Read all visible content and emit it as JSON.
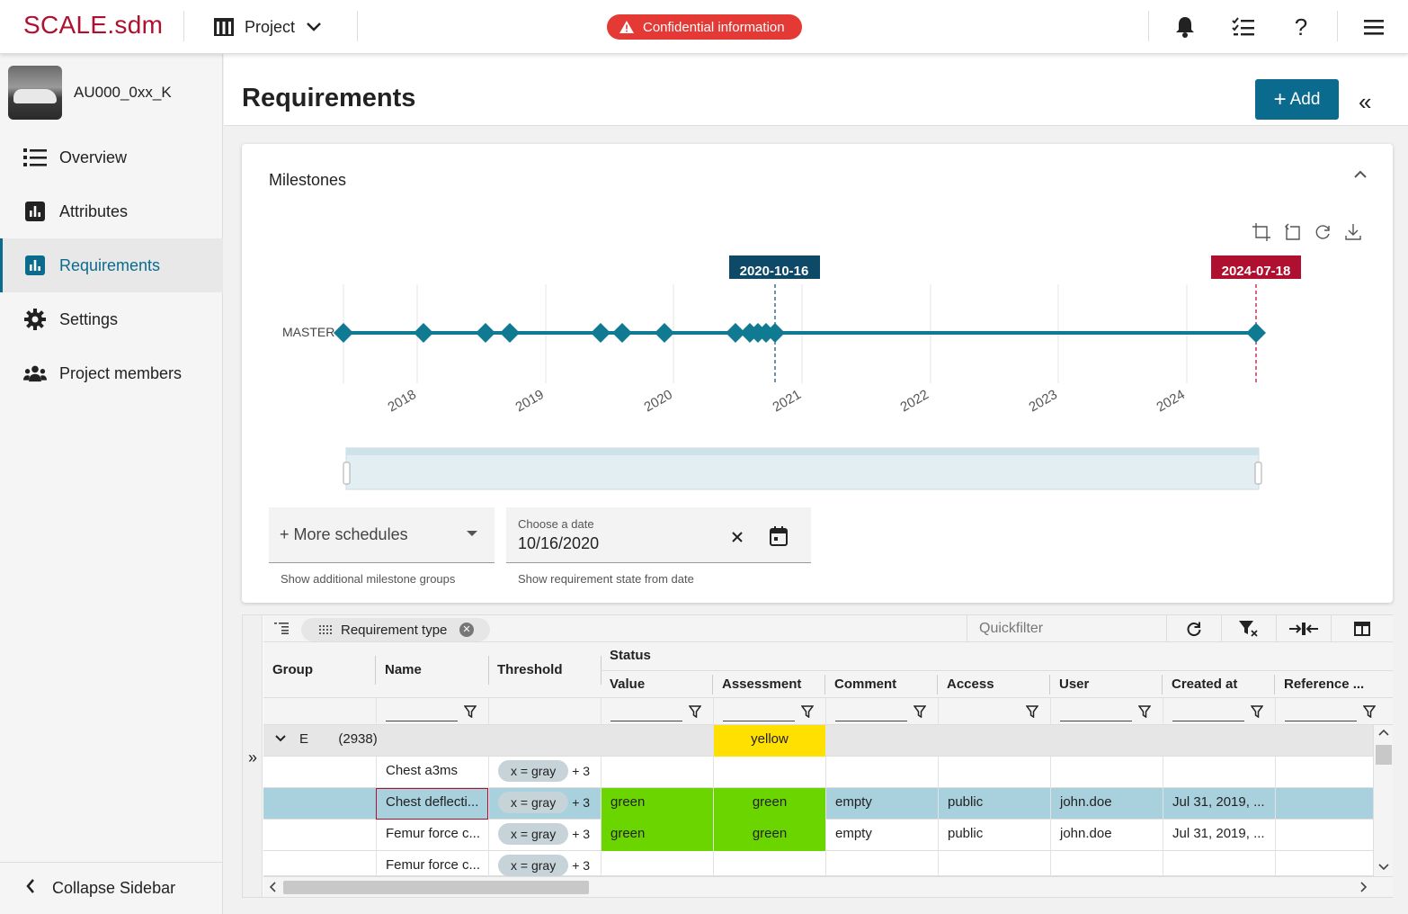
{
  "app": {
    "logo": "SCALE.sdm",
    "project_label": "Project",
    "confidential": "Confidential information"
  },
  "sidebar": {
    "project_name": "AU000_0xx_K",
    "items": [
      {
        "label": "Overview",
        "icon": "list-icon"
      },
      {
        "label": "Attributes",
        "icon": "bar-chart-icon"
      },
      {
        "label": "Requirements",
        "icon": "bar-chart-icon",
        "active": true
      },
      {
        "label": "Settings",
        "icon": "gear-icon"
      },
      {
        "label": "Project members",
        "icon": "people-icon"
      }
    ],
    "collapse_label": "Collapse Sidebar"
  },
  "header": {
    "title": "Requirements",
    "add_label": "Add"
  },
  "milestones": {
    "title": "Milestones",
    "series_label": "MASTER",
    "marker_left": "2020-10-16",
    "marker_right": "2024-07-18",
    "years": [
      "2018",
      "2019",
      "2020",
      "2021",
      "2022",
      "2023",
      "2024"
    ],
    "more_schedules": "More schedules",
    "more_schedules_hint": "Show additional milestone groups",
    "date_label": "Choose a date",
    "date_value": "10/16/2020",
    "date_hint": "Show requirement state from date"
  },
  "grid": {
    "group_chip": "Requirement type",
    "quickfilter_placeholder": "Quickfilter",
    "headers": {
      "group": "Group",
      "name": "Name",
      "threshold": "Threshold",
      "status": "Status",
      "value": "Value",
      "assessment": "Assessment",
      "comment": "Comment",
      "access": "Access",
      "user": "User",
      "created_at": "Created at",
      "reference": "Reference ..."
    },
    "group_row": {
      "label": "E",
      "count": "(2938)",
      "assessment": "yellow"
    },
    "rows": [
      {
        "name": "Chest a3ms",
        "threshold": "x = gray",
        "more": "+ 3",
        "value": "",
        "assessment": "",
        "comment": "",
        "access": "",
        "user": "",
        "created_at": ""
      },
      {
        "name": "Chest deflecti...",
        "threshold": "x = gray",
        "more": "+ 3",
        "value": "green",
        "assessment": "green",
        "comment": "empty",
        "access": "public",
        "user": "john.doe",
        "created_at": "Jul 31, 2019, ..."
      },
      {
        "name": "Femur force c...",
        "threshold": "x = gray",
        "more": "+ 3",
        "value": "green",
        "assessment": "green",
        "comment": "empty",
        "access": "public",
        "user": "john.doe",
        "created_at": "Jul 31, 2019, ..."
      },
      {
        "name": "Femur force c...",
        "threshold": "x = gray",
        "more": "+ 3",
        "value": "",
        "assessment": "",
        "comment": "",
        "access": "",
        "user": "",
        "created_at": ""
      }
    ]
  }
}
